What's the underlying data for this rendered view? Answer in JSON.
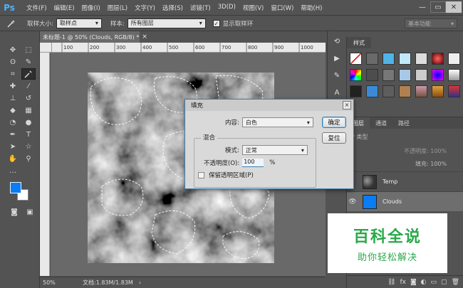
{
  "app": {
    "logo": "Ps",
    "menu": [
      "文件(F)",
      "编辑(E)",
      "图像(I)",
      "图层(L)",
      "文字(Y)",
      "选择(S)",
      "滤镜(T)",
      "3D(D)",
      "视图(V)",
      "窗口(W)",
      "帮助(H)"
    ],
    "window_controls": {
      "minimize": "—",
      "restore": "▭",
      "close": "✕"
    }
  },
  "options_bar": {
    "sample_size_label": "取样大小:",
    "sample_size_value": "取样点",
    "sample_label": "样本:",
    "sample_value": "所有图层",
    "show_ring_label": "显示取样环",
    "workspace": "基本功能"
  },
  "document": {
    "tab_title": "未标题-1 @ 50% (Clouds, RGB/8) *",
    "zoom": "50%",
    "doc_info": "文档:1.83M/1.83M",
    "ruler_ticks": [
      "100",
      "200",
      "300",
      "400",
      "500",
      "600",
      "700",
      "800",
      "900",
      "1000"
    ]
  },
  "colors": {
    "foreground": "#0a7cf4",
    "background": "#ffffff",
    "dialog_accent": "#3c7fb1"
  },
  "styles_panel": {
    "tab": "样式"
  },
  "layers_panel": {
    "tabs": [
      "图层",
      "通道",
      "路径"
    ],
    "kind_placeholder": "P 类型",
    "opacity_label": "不透明度: 100%",
    "fill_label": "填充: 100%",
    "layers": [
      {
        "name": "Temp",
        "visible": false,
        "selected": false
      },
      {
        "name": "Clouds",
        "visible": true,
        "selected": true
      }
    ]
  },
  "fill_dialog": {
    "title": "填充",
    "content_label": "内容:",
    "content_value": "白色",
    "blend_group": "混合",
    "mode_label": "模式:",
    "mode_value": "正常",
    "opacity_label": "不透明度(O):",
    "opacity_value": "100",
    "opacity_unit": "%",
    "preserve_label": "保留透明区域(P)",
    "ok": "确定",
    "reset": "复位"
  },
  "watermark": {
    "line1": "百科全说",
    "line2": "助你轻松解决"
  }
}
